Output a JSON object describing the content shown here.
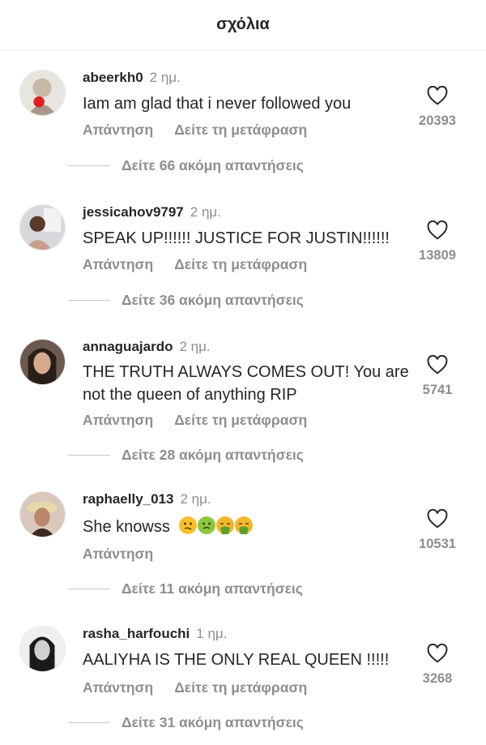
{
  "header": {
    "title": "σχόλια"
  },
  "labels": {
    "reply": "Απάντηση",
    "translate": "Δείτε τη μετάφραση"
  },
  "comments": [
    {
      "username": "abeerkh0",
      "time": "2 ημ.",
      "text": "Iam am glad that i never followed you",
      "likes": "20393",
      "replies": "Δείτε 66 ακόμη απαντήσεις"
    },
    {
      "username": "jessicahov9797",
      "time": "2 ημ.",
      "text": "SPEAK UP!!!!!! JUSTICE FOR JUSTIN!!!!!!",
      "likes": "13809",
      "replies": "Δείτε 36 ακόμη απαντήσεις"
    },
    {
      "username": "annaguajardo",
      "time": "2 ημ.",
      "text": "THE TRUTH ALWAYS COMES OUT! You are not the queen of anything RIP",
      "likes": "5741",
      "replies": "Δείτε 28 ακόμη απαντήσεις"
    },
    {
      "username": "raphaelly_013",
      "time": "2 ημ.",
      "text": "She knowss",
      "emojis": [
        "confused-face",
        "nauseated-face",
        "vomiting-face",
        "vomiting-face"
      ],
      "likes": "10531",
      "replies": "Δείτε 11 ακόμη απαντήσεις"
    },
    {
      "username": "rasha_harfouchi",
      "time": "1 ημ.",
      "text": "AALIYHA IS THE ONLY REAL QUEEN !!!!!",
      "likes": "3268",
      "replies": "Δείτε 31 ακόμη απαντήσεις"
    }
  ]
}
